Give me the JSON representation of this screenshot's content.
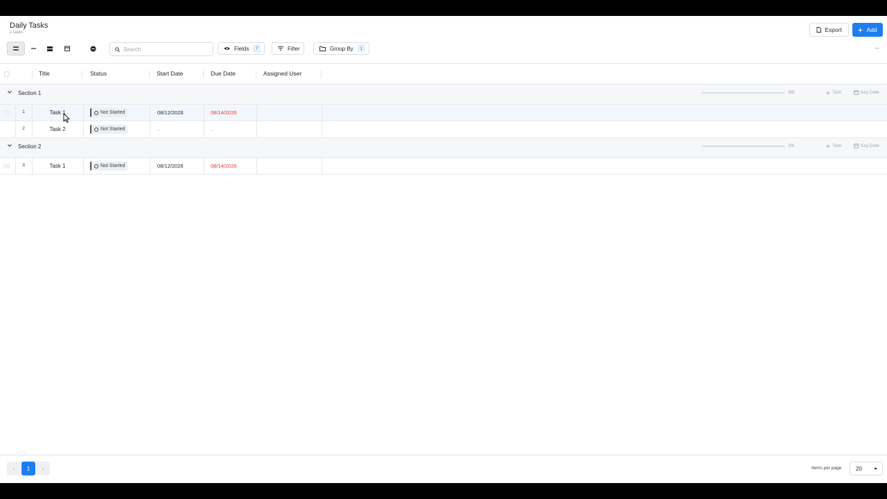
{
  "header": {
    "title": "Daily Tasks",
    "subtitle": "2 tasks",
    "export_label": "Export",
    "add_label": "Add"
  },
  "toolbar": {
    "search_placeholder": "Search",
    "fields_label": "Fields",
    "fields_count": "7",
    "filter_label": "Filter",
    "group_by_label": "Group By",
    "group_by_count": "1",
    "more_label": "···"
  },
  "columns": [
    "Title",
    "Status",
    "Start Date",
    "Due Date",
    "Assigned User"
  ],
  "sections": [
    {
      "name": "Section 1",
      "progress_text": "0/2",
      "progress_fraction": 0,
      "add_task_label": "Task",
      "key_date_label": "Key Date",
      "rows": [
        {
          "num": "1",
          "title": "Task 1",
          "status": "Not Started",
          "start_date": "08/12/2026",
          "due_date": "08/14/2026"
        },
        {
          "num": "2",
          "title": "Task 2",
          "status": "Not Started",
          "start_date": "–",
          "due_date": "–"
        }
      ]
    },
    {
      "name": "Section 2",
      "progress_text": "0/1",
      "progress_fraction": 0,
      "add_task_label": "Task",
      "key_date_label": "Key Date",
      "rows": [
        {
          "num": "3",
          "title": "Task 1",
          "status": "Not Started",
          "start_date": "08/12/2026",
          "due_date": "08/14/2026"
        }
      ]
    }
  ],
  "pagination": {
    "prev": "‹",
    "current_page": "1",
    "next": "›",
    "items_per_page_label": "Items per page",
    "items_per_page_value": "20"
  },
  "colors": {
    "accent": "#1e7ef0",
    "overdue": "#d93a3a"
  }
}
